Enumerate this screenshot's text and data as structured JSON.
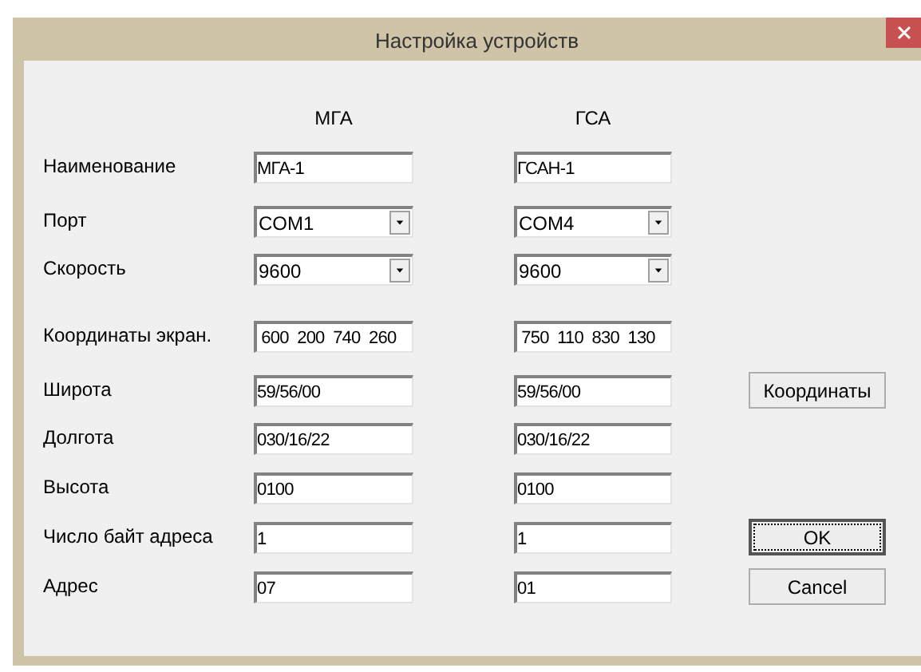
{
  "window": {
    "title": "Настройка устройств"
  },
  "columns": [
    "МГА",
    "ГСА"
  ],
  "rows": [
    {
      "label": "Наименование",
      "kind": "text",
      "values": [
        "МГА-1",
        "ГСАН-1"
      ]
    },
    {
      "label": "Порт",
      "kind": "combo",
      "values": [
        "COM1",
        "COM4"
      ]
    },
    {
      "label": "Скорость",
      "kind": "combo",
      "values": [
        "9600",
        "9600"
      ]
    },
    {
      "label": "Координаты экран.",
      "kind": "text",
      "values": [
        " 600  200  740  260",
        " 750  110  830  130"
      ]
    },
    {
      "label": "Широта",
      "kind": "text",
      "values": [
        "59/56/00",
        "59/56/00"
      ],
      "button": {
        "label": "Координаты",
        "default": false
      }
    },
    {
      "label": "Долгота",
      "kind": "text",
      "values": [
        "030/16/22",
        "030/16/22"
      ]
    },
    {
      "label": "Высота",
      "kind": "text",
      "values": [
        "0100",
        "0100"
      ]
    },
    {
      "label": "Число байт адреса",
      "kind": "text",
      "values": [
        "1",
        "1"
      ],
      "button": {
        "label": "OK",
        "default": true
      }
    },
    {
      "label": "Адрес",
      "kind": "text",
      "values": [
        "07",
        "01"
      ],
      "button": {
        "label": "Cancel",
        "default": false
      }
    }
  ]
}
